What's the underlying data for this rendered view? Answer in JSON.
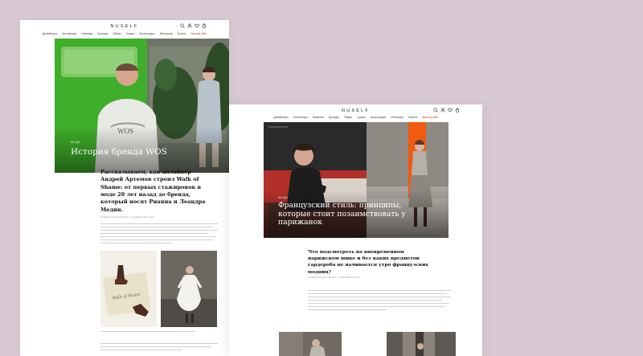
{
  "left_page": {
    "logo": "NUSELF",
    "nav": [
      "Дизайнеры",
      "Коллекции",
      "Новинки",
      "Бренды",
      "Обувь",
      "Сумки",
      "Аксессуары",
      "Интерьер",
      "Бьюти",
      "Special offer"
    ],
    "hero": {
      "tag": "МОДА",
      "title": "История бренда WOS"
    },
    "lead": "Рассказываем, как дизайнер Андрей Артемов строил Walk of Shame: от первых стажировок в моде 20 лет назад до бренда, который носят Рианна и Леандра Медин.",
    "meta": "СОФИЯ ЗАХАРЧЕНКО / 18 ДЕКАБРЯ 2020"
  },
  "right_page": {
    "logo": "NUSELF",
    "nav": [
      "Дизайнеры",
      "Коллекции",
      "Новинки",
      "Бренды",
      "Обувь",
      "Сумки",
      "Аксессуары",
      "Интерьер",
      "Бьюти",
      "Special offer"
    ],
    "hero": {
      "tag": "МОДА",
      "title": "Французский стиль: принципы, которые стоит позаимствовать у парижанок"
    },
    "lead": "Что подсмотреть во вневременном парижском шике и без каких предметов гардероба не начинается утро французских модниц?",
    "meta": "СОФИЯ ЗАХАРЧЕНКО / 23 ЯНВАРЯ 2021"
  },
  "colors": {
    "background": "#d9c9d2",
    "accent": "#c0392b",
    "orange_panel": "#f25a12",
    "green_panel": "#3fae2a"
  }
}
